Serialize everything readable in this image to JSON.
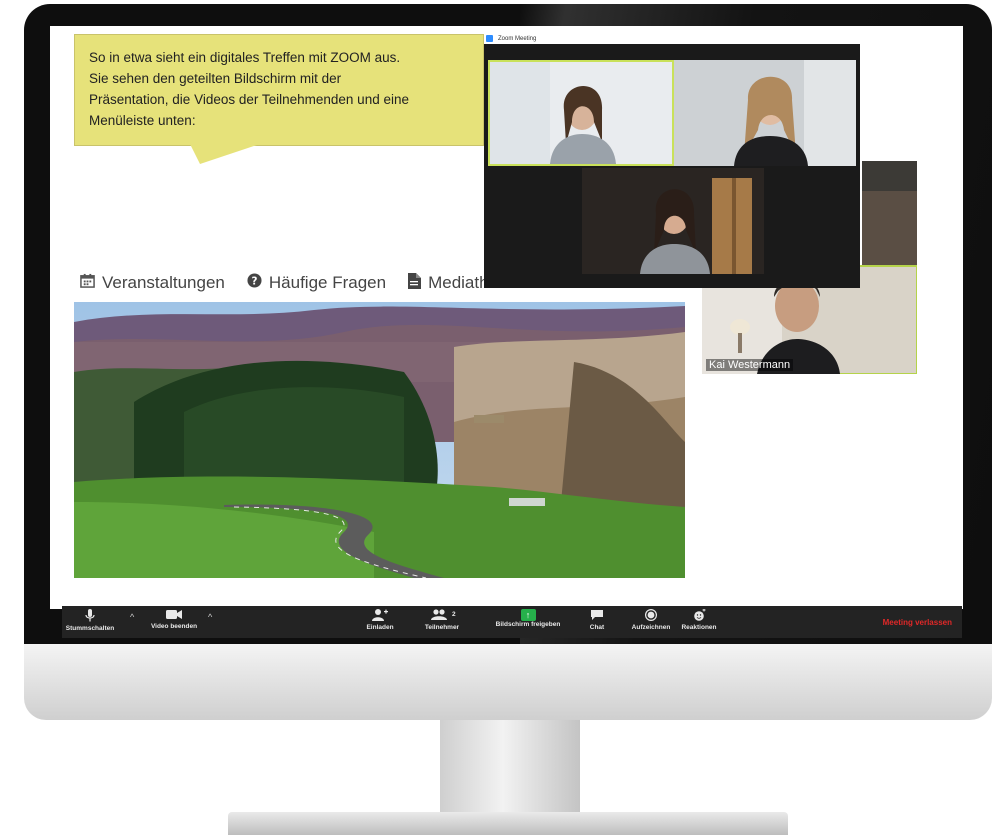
{
  "speech_bubble": {
    "lines": [
      "So in etwa sieht ein digitales Treffen mit ZOOM aus.",
      "Sie sehen den geteilten Bildschirm mit der",
      "Präsentation, die Videos der Teilnehmenden und eine",
      "Menüleiste unten:"
    ]
  },
  "nav": {
    "events": "Veranstaltungen",
    "faq": "Häufige Fragen",
    "media": "Mediathek"
  },
  "zoom_window": {
    "title": "Zoom Meeting",
    "participants": [
      "",
      "",
      ""
    ]
  },
  "side_video": {
    "name": "Kai Westermann"
  },
  "toolbar": {
    "mute": "Stummschalten",
    "stop_video": "Video beenden",
    "invite": "Einladen",
    "participants": "Teilnehmer",
    "participants_count": "2",
    "share": "Bildschirm freigeben",
    "chat": "Chat",
    "record": "Aufzeichnen",
    "reactions": "Reaktionen",
    "leave": "Meeting verlassen"
  },
  "colors": {
    "bubble": "#e6e27a",
    "toolbar": "#232323",
    "share_green": "#26b04b",
    "leave_red": "#e02828",
    "active_speaker_border": "#b5d34a"
  },
  "icons": {
    "events": "calendar-icon",
    "faq": "question-circle-icon",
    "media": "document-icon"
  }
}
